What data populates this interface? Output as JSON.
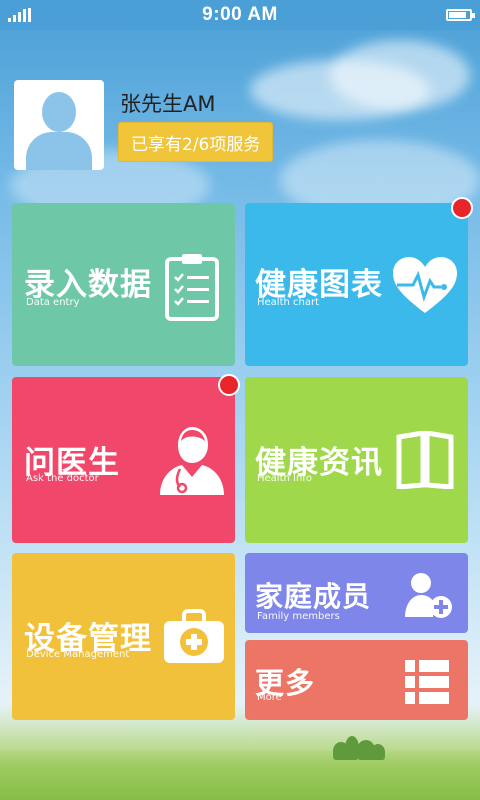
{
  "status_bar": {
    "time": "9:00 AM"
  },
  "profile": {
    "name": "张先生AM",
    "services": "已享有2/6项服务"
  },
  "tiles": [
    {
      "cn": "录入数据",
      "en": "Data entry",
      "icon": "clipboard-checklist-icon",
      "color": "#6ec8a8",
      "badge": false
    },
    {
      "cn": "健康图表",
      "en": "Health chart",
      "icon": "heart-pulse-icon",
      "color": "#3bb9ea",
      "badge": true
    },
    {
      "cn": "问医生",
      "en": "Ask the doctor",
      "icon": "doctor-icon",
      "color": "#f1476a",
      "badge": true
    },
    {
      "cn": "健康资讯",
      "en": "Health Info",
      "icon": "open-book-icon",
      "color": "#9fd84a",
      "badge": false
    },
    {
      "cn": "设备管理",
      "en": "Device Management",
      "icon": "medical-kit-icon",
      "color": "#f2c13b",
      "badge": false
    },
    {
      "cn": "家庭成员",
      "en": "Family members",
      "icon": "add-user-icon",
      "color": "#7f86ea",
      "badge": false
    },
    {
      "cn": "更多",
      "en": "More",
      "icon": "list-icon",
      "color": "#ec7565",
      "badge": false
    }
  ]
}
